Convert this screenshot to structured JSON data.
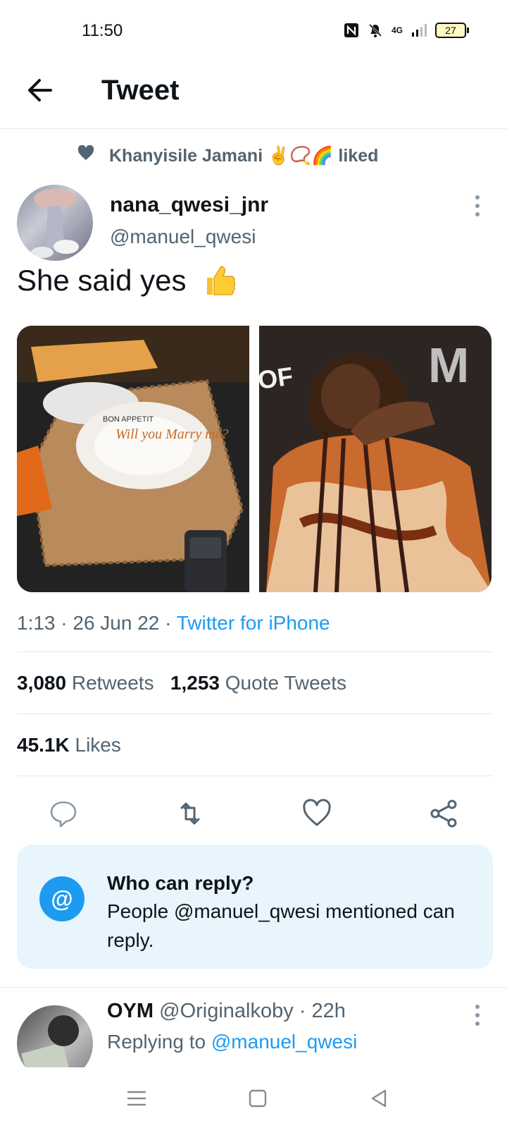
{
  "status_bar": {
    "time": "11:50",
    "network": "4G",
    "battery": "27"
  },
  "header": {
    "title": "Tweet"
  },
  "social_context": {
    "text": "Khanyisile Jamani ✌️📿🌈 liked"
  },
  "tweet": {
    "display_name": "nana_qwesi_jnr",
    "handle": "@manuel_qwesi",
    "text": "She said yes",
    "plate_text": "Will you Marry me?",
    "plate_rim": "BON APPETIT",
    "timestamp": "1:13 · 26 Jun 22 · ",
    "source": "Twitter for iPhone",
    "retweets_count": "3,080",
    "retweets_label": "Retweets",
    "quotes_count": "1,253",
    "quotes_label": "Quote Tweets",
    "likes_count": "45.1K",
    "likes_label": "Likes"
  },
  "who_can_reply": {
    "icon": "@",
    "title": "Who can reply?",
    "body": "People @manuel_qwesi mentioned can reply."
  },
  "reply": {
    "display_name": "OYM",
    "handle": "@Originalkoby",
    "time": " · 22h",
    "replying_prefix": "Replying to ",
    "replying_to": "@manuel_qwesi"
  },
  "colors": {
    "accent": "#1d9bf0",
    "secondary_text": "#536471",
    "reply_card_bg": "#e8f5fd"
  }
}
